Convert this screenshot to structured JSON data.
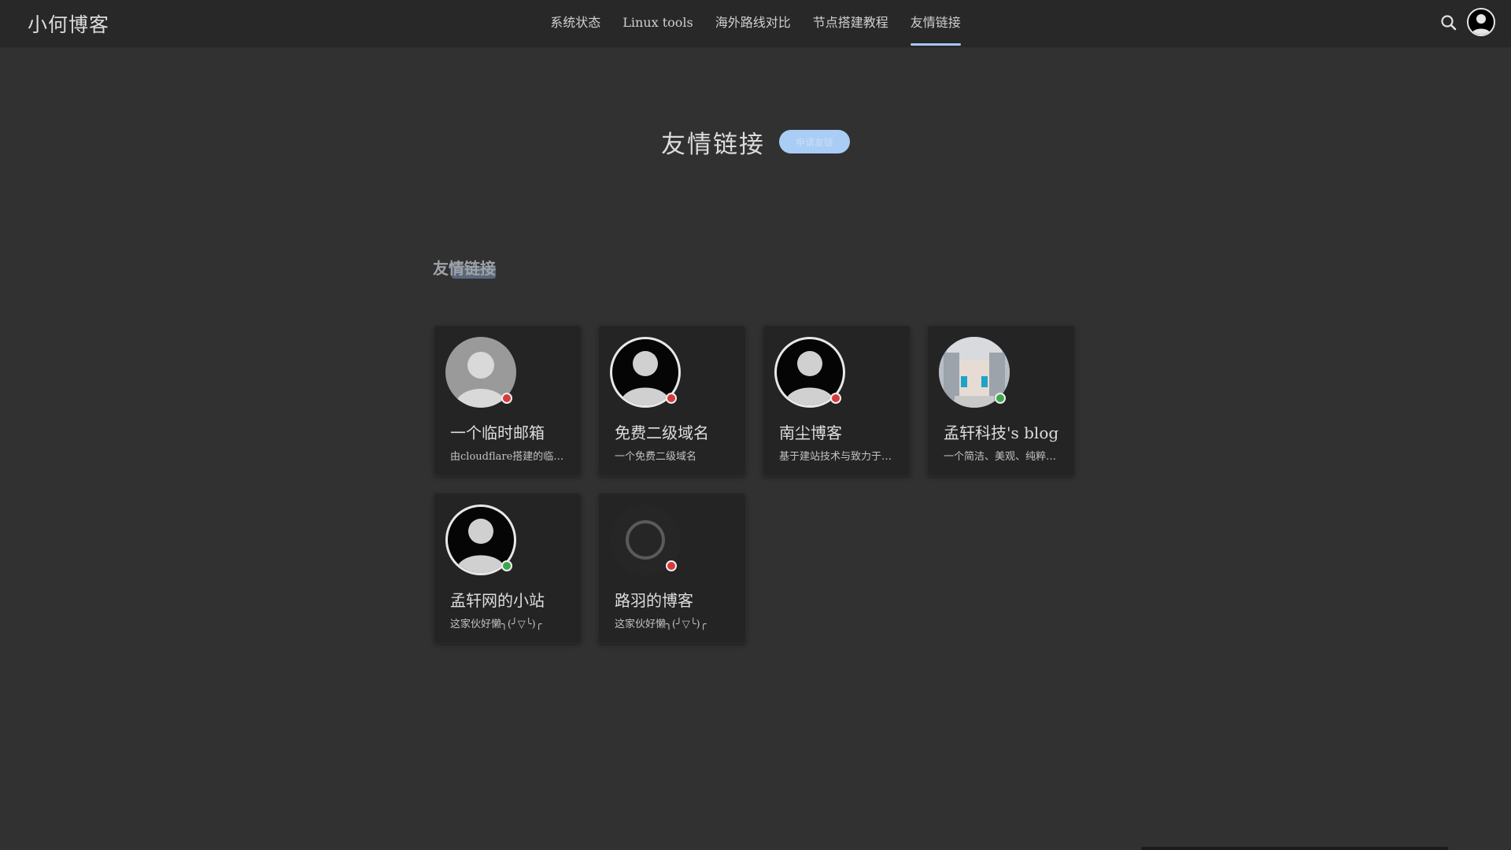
{
  "header": {
    "brand": "小何博客",
    "nav": [
      {
        "label": "系统状态"
      },
      {
        "label": "Linux tools"
      },
      {
        "label": "海外路线对比"
      },
      {
        "label": "节点搭建教程"
      },
      {
        "label": "友情链接",
        "active": true
      }
    ],
    "icons": {
      "search": "search-icon",
      "user": "user-avatar-icon"
    }
  },
  "page": {
    "title": "友情链接",
    "badge": "申请友链"
  },
  "section": {
    "title": "友情链接"
  },
  "colors": {
    "accent": "#a9c8f0",
    "online": "#3fa64a",
    "offline": "#d63a3a"
  },
  "links": [
    {
      "name": "一个临时邮箱",
      "desc": "由cloudflare搭建的临时邮箱",
      "status": "offline",
      "avatar": "default-light"
    },
    {
      "name": "免费二级域名",
      "desc": "一个免费二级域名",
      "status": "offline",
      "avatar": "default-dark"
    },
    {
      "name": "南尘博客",
      "desc": "基于建站技术与致力于分享",
      "status": "offline",
      "avatar": "default-dark"
    },
    {
      "name": "孟轩科技's blog",
      "desc": "一个简洁、美观、纯粹的博客",
      "status": "online",
      "avatar": "pixel"
    },
    {
      "name": "孟轩网的小站",
      "desc": "这家伙好懒╮(╯▽╰)╭",
      "status": "online",
      "avatar": "default-dark"
    },
    {
      "name": "路羽的博客",
      "desc": "这家伙好懒╮(╯▽╰)╭",
      "status": "offline",
      "avatar": "loading"
    }
  ]
}
